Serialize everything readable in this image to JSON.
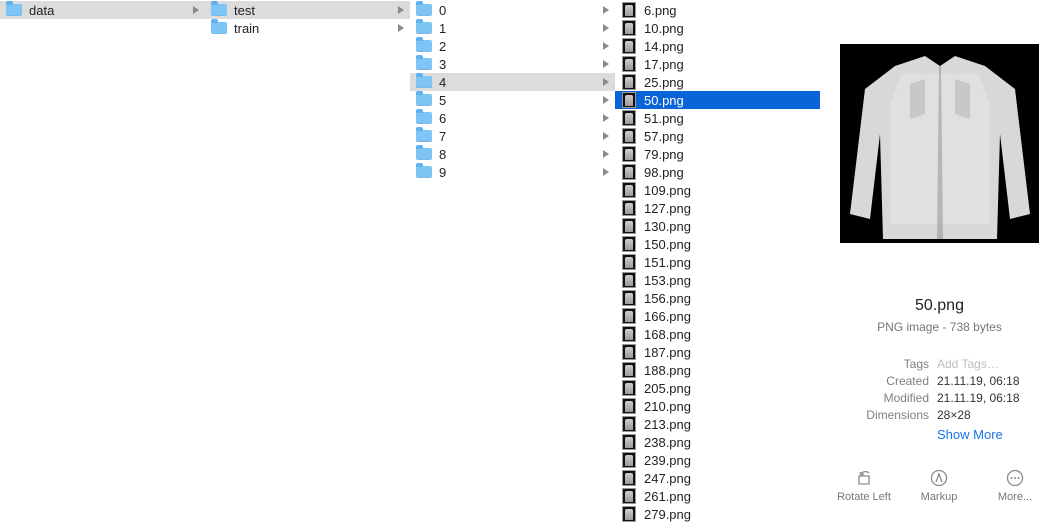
{
  "columns": [
    {
      "items": [
        {
          "label": "data",
          "arrow": true,
          "selected": "gray"
        }
      ]
    },
    {
      "items": [
        {
          "label": "test",
          "arrow": true,
          "selected": "gray"
        },
        {
          "label": "train",
          "arrow": true
        }
      ]
    },
    {
      "items": [
        {
          "label": "0",
          "arrow": true
        },
        {
          "label": "1",
          "arrow": true
        },
        {
          "label": "2",
          "arrow": true
        },
        {
          "label": "3",
          "arrow": true
        },
        {
          "label": "4",
          "arrow": true,
          "selected": "gray"
        },
        {
          "label": "5",
          "arrow": true
        },
        {
          "label": "6",
          "arrow": true
        },
        {
          "label": "7",
          "arrow": true
        },
        {
          "label": "8",
          "arrow": true
        },
        {
          "label": "9",
          "arrow": true
        }
      ]
    },
    {
      "items": [
        "6.png",
        "10.png",
        "14.png",
        "17.png",
        "25.png",
        "50.png",
        "51.png",
        "57.png",
        "79.png",
        "98.png",
        "109.png",
        "127.png",
        "130.png",
        "150.png",
        "151.png",
        "153.png",
        "156.png",
        "166.png",
        "168.png",
        "187.png",
        "188.png",
        "205.png",
        "210.png",
        "213.png",
        "238.png",
        "239.png",
        "247.png",
        "261.png",
        "279.png"
      ],
      "selected_index": 5
    }
  ],
  "preview": {
    "filename": "50.png",
    "subtitle": "PNG image - 738 bytes",
    "meta": [
      {
        "label": "Tags",
        "value": "Add Tags…",
        "placeholder": true
      },
      {
        "label": "Created",
        "value": "21.11.19, 06:18"
      },
      {
        "label": "Modified",
        "value": "21.11.19, 06:18"
      },
      {
        "label": "Dimensions",
        "value": "28×28"
      }
    ],
    "show_more": "Show More",
    "actions": [
      {
        "label": "Rotate Left",
        "icon": "rotate-left-icon"
      },
      {
        "label": "Markup",
        "icon": "markup-icon"
      },
      {
        "label": "More...",
        "icon": "more-icon"
      }
    ]
  }
}
